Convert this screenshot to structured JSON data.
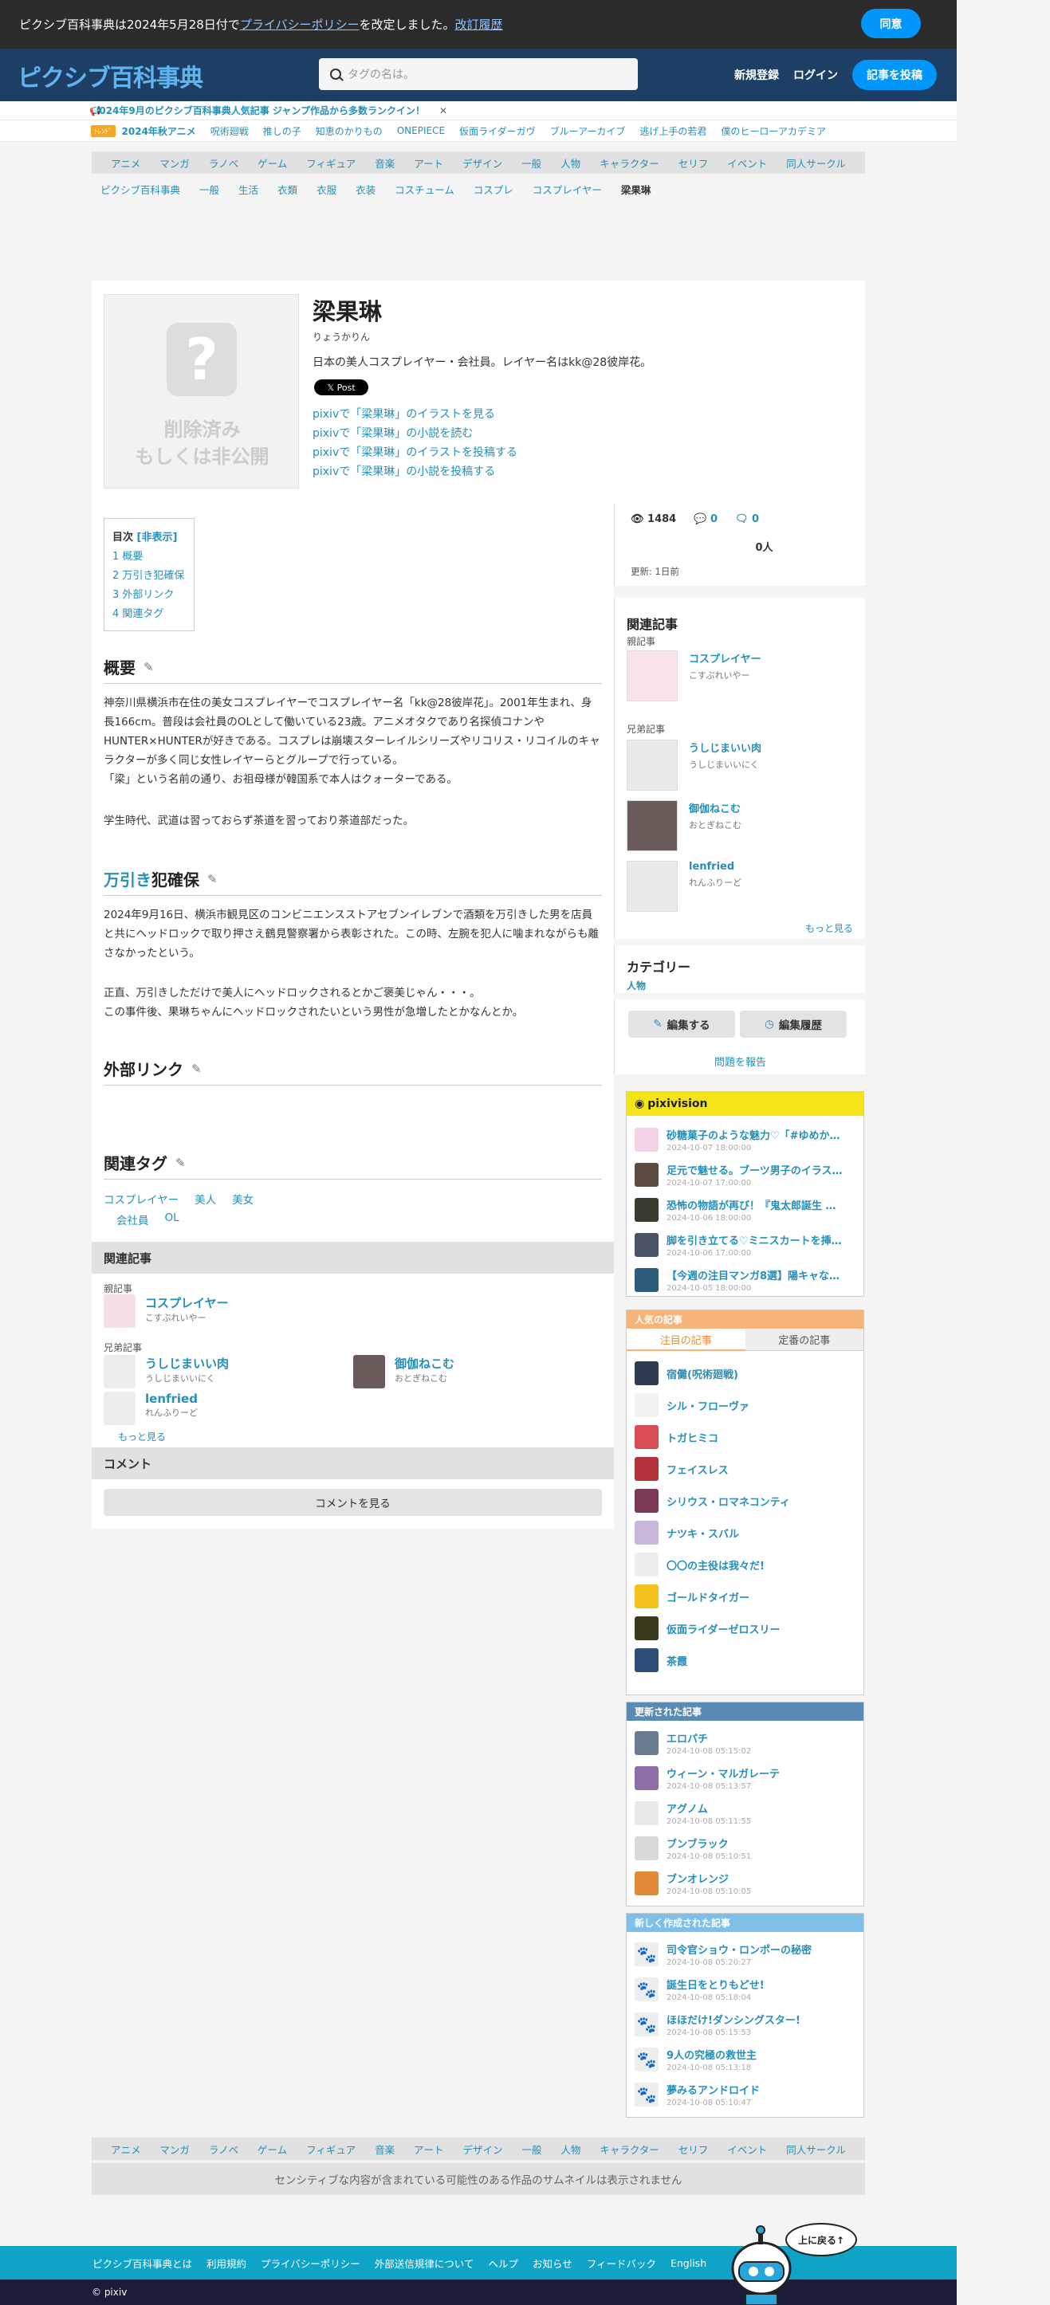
{
  "consent": {
    "text_prefix": "ピクシブ百科事典は2024年5月28日付で",
    "policy_link": "プライバシーポリシー",
    "text_suffix": "を改定しました。",
    "history_link": "改訂履歴",
    "agree": "同意"
  },
  "header": {
    "logo": "ピクシブ百科事典",
    "search_placeholder": "タグの名は。",
    "register": "新規登録",
    "login": "ログイン",
    "post": "記事を投稿"
  },
  "notice": {
    "text": "2024年9月のピクシブ百科事典人気記事 ジャンプ作品から多数ランクイン！",
    "close": "✕"
  },
  "trend": {
    "badge": "ﾄﾚﾝﾄﾞ",
    "items": [
      "2024年秋アニメ",
      "呪術廻戦",
      "推しの子",
      "知恵のかりもの",
      "ONEPIECE",
      "仮面ライダーガヴ",
      "ブルーアーカイブ",
      "逃げ上手の若君",
      "僕のヒーローアカデミア"
    ]
  },
  "nav": [
    "アニメ",
    "マンガ",
    "ラノベ",
    "ゲーム",
    "フィギュア",
    "音楽",
    "アート",
    "デザイン",
    "一般",
    "人物",
    "キャラクター",
    "セリフ",
    "イベント",
    "同人サークル"
  ],
  "breadcrumb": [
    "ピクシブ百科事典",
    "一般",
    "生活",
    "衣類",
    "衣服",
    "衣装",
    "コスチューム",
    "コスプレ",
    "コスプレイヤー",
    "梁果琳"
  ],
  "article": {
    "thumb_text1": "削除済み",
    "thumb_text2": "もしくは非公開",
    "title": "梁果琳",
    "reading": "りょうかりん",
    "summary": "日本の美人コスプレイヤー・会社員。レイヤー名はkk@28彼岸花。",
    "xpost": "𝕏 Post",
    "pixiv_links": [
      "pixivで「梁果琳」のイラストを見る",
      "pixivで「梁果琳」の小説を読む",
      "pixivで「梁果琳」のイラストを投稿する",
      "pixivで「梁果琳」の小説を投稿する"
    ],
    "toc_title": "目次",
    "toc_toggle": "[非表示]",
    "toc": [
      "1 概要",
      "2 万引き犯確保",
      "3 外部リンク",
      "4 関連タグ"
    ],
    "h_overview": "概要",
    "overview_p1": "神奈川県横浜市在住の美女コスプレイヤーでコスプレイヤー名「kk@28彼岸花」。2001年生まれ、身長166cm。普段は会社員のOLとして働いている23歳。アニメオタクであり名探偵コナンやHUNTER×HUNTERが好きである。コスプレは崩壊スターレイルシリーズやリコリス・リコイルのキャラクターが多く同じ女性レイヤーらとグループで行っている。",
    "overview_p2": "「梁」という名前の通り、お祖母様が韓国系で本人はクォーターである。",
    "overview_p3": "学生時代、武道は習っておらず茶道を習っており茶道部だった。",
    "h_shoplift_1": "万引き",
    "h_shoplift_2": "犯確保",
    "shoplift_p1": "2024年9月16日、横浜市観見区のコンビニエンスストアセブンイレブンで酒類を万引きした男を店員と共にヘッドロックで取り押さえ鶴見警察署から表彰された。この時、左腕を犯人に噛まれながらも離さなかったという。",
    "shoplift_p2": "正直、万引きしただけで美人にヘッドロックされるとかご褒美じゃん・・・。",
    "shoplift_p3": "この事件後、果琳ちゃんにヘッドロックされたいという男性が急増したとかなんとか。",
    "h_links": "外部リンク",
    "h_tags": "関連タグ",
    "tags_row1": [
      "コスプレイヤー",
      "美人",
      "美女"
    ],
    "tags_row2": [
      "会社員",
      "OL"
    ],
    "related_bar": "関連記事",
    "parent_label": "親記事",
    "parent": {
      "name": "コスプレイヤー",
      "reading": "こすぷれいやー"
    },
    "siblings_label": "兄弟記事",
    "siblings": [
      {
        "name": "うしじまいい肉",
        "reading": "うしじまいいにく"
      },
      {
        "name": "御伽ねこむ",
        "reading": "おとぎねこむ"
      },
      {
        "name": "lenfried",
        "reading": "れんふりーど"
      }
    ],
    "more": "もっと見る",
    "comment_bar": "コメント",
    "comment_btn": "コメントを見る"
  },
  "stats": {
    "views": "1484",
    "comments": "0",
    "replies": "0",
    "people": "0人",
    "updated": "更新: 1日前"
  },
  "side_related": {
    "title": "関連記事",
    "parent_label": "親記事",
    "parent": {
      "name": "コスプレイヤー",
      "reading": "こすぷれいやー"
    },
    "siblings_label": "兄弟記事",
    "siblings": [
      {
        "name": "うしじまいい肉",
        "reading": "うしじまいいにく"
      },
      {
        "name": "御伽ねこむ",
        "reading": "おとぎねこむ"
      },
      {
        "name": "lenfried",
        "reading": "れんふりーど"
      }
    ],
    "more": "もっと見る"
  },
  "category": {
    "title": "カテゴリー",
    "value": "人物"
  },
  "actions": {
    "edit": "編集する",
    "history": "編集履歴",
    "report": "問題を報告"
  },
  "pixivision": {
    "title": "pixivision",
    "items": [
      {
        "t": "砂糖菓子のような魅力♡「#ゆめか…",
        "d": "2024-10-07 18:00:00"
      },
      {
        "t": "足元で魅せる。ブーツ男子のイラス…",
        "d": "2024-10-07 17:00:00"
      },
      {
        "t": "恐怖の物語が再び！『鬼太郎誕生 …",
        "d": "2024-10-06 18:00:00"
      },
      {
        "t": "脚を引き立てる♡ミニスカートを挿…",
        "d": "2024-10-06 17:00:00"
      },
      {
        "t": "【今週の注目マンガ8選】陽キャな…",
        "d": "2024-10-05 18:00:00"
      }
    ]
  },
  "popular": {
    "title": "人気の記事",
    "tab_trend": "注目の記事",
    "tab_classic": "定番の記事",
    "items": [
      "宿儺(呪術廻戦)",
      "シル・フローヴァ",
      "トガヒミコ",
      "フェイスレス",
      "シリウス・ロマネコンティ",
      "ナツキ・スバル",
      "〇〇の主役は我々だ!",
      "ゴールドタイガー",
      "仮面ライダーゼロスリー",
      "茶霞"
    ]
  },
  "updated": {
    "title": "更新された記事",
    "items": [
      {
        "t": "エロパチ",
        "d": "2024-10-08 05:15:02"
      },
      {
        "t": "ウィーン・マルガレーテ",
        "d": "2024-10-08 05:13:57"
      },
      {
        "t": "アグノム",
        "d": "2024-10-08 05:11:55"
      },
      {
        "t": "ブンブラック",
        "d": "2024-10-08 05:10:51"
      },
      {
        "t": "ブンオレンジ",
        "d": "2024-10-08 05:10:05"
      }
    ]
  },
  "new_articles": {
    "title": "新しく作成された記事",
    "items": [
      {
        "t": "司令官ショウ・ロンポーの秘密",
        "d": "2024-10-08 05:20:27"
      },
      {
        "t": "誕生日をとりもどせ!",
        "d": "2024-10-08 05:18:04"
      },
      {
        "t": "ほほだけ!ダンシングスター!",
        "d": "2024-10-08 05:15:53"
      },
      {
        "t": "9人の究極の救世主",
        "d": "2024-10-08 05:13:18"
      },
      {
        "t": "夢みるアンドロイド",
        "d": "2024-10-08 05:10:47"
      }
    ]
  },
  "sensitive": "センシティブな内容が含まれている可能性のある作品のサムネイルは表示されません",
  "footer": [
    "ピクシブ百科事典とは",
    "利用規約",
    "プライバシーポリシー",
    "外部送信規律について",
    "ヘルプ",
    "お知らせ",
    "フィードバック",
    "English"
  ],
  "totop": "上に戻る↑",
  "copyright": "© pixiv"
}
